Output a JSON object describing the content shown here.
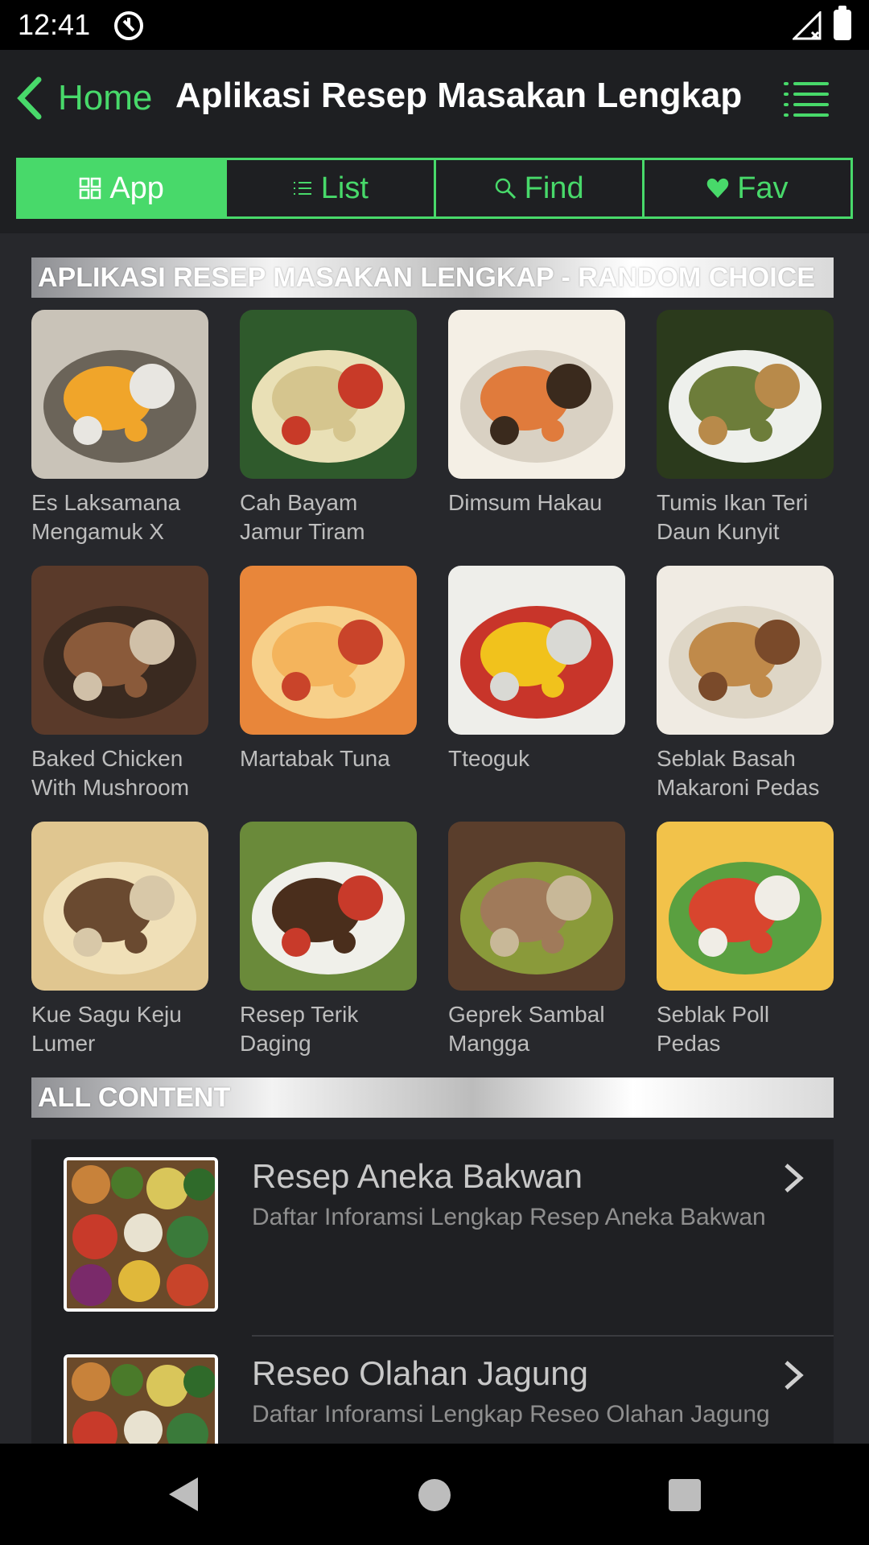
{
  "status_bar": {
    "time": "12:41"
  },
  "header": {
    "back_label": "Home",
    "title": "Aplikasi Resep Masakan Lengkap",
    "menu_icon": "list-menu-icon",
    "accent_color": "#48d96a"
  },
  "tabs": [
    {
      "label": "App",
      "icon": "grid-icon",
      "active": true
    },
    {
      "label": "List",
      "icon": "list-icon",
      "active": false
    },
    {
      "label": "Find",
      "icon": "search-icon",
      "active": false
    },
    {
      "label": "Fav",
      "icon": "heart-icon",
      "active": false
    }
  ],
  "random_section": {
    "title": "APLIKASI RESEP MASAKAN LENGKAP - RANDOM CHOICE",
    "recipes": [
      {
        "name": "Es Laksamana Mengamuk X"
      },
      {
        "name": "Cah Bayam Jamur Tiram"
      },
      {
        "name": "Dimsum Hakau"
      },
      {
        "name": "Tumis Ikan Teri Daun Kunyit"
      },
      {
        "name": "Baked Chicken With Mushroom"
      },
      {
        "name": "Martabak Tuna"
      },
      {
        "name": "Tteoguk"
      },
      {
        "name": "Seblak Basah Makaroni Pedas"
      },
      {
        "name": "Kue Sagu Keju Lumer"
      },
      {
        "name": "Resep Terik Daging"
      },
      {
        "name": "Geprek Sambal Mangga"
      },
      {
        "name": "Seblak Poll Pedas"
      }
    ]
  },
  "all_content": {
    "title": "ALL CONTENT",
    "items": [
      {
        "title": "Resep Aneka Bakwan",
        "description": "Daftar Inforamsi Lengkap Resep Aneka Bakwan"
      },
      {
        "title": "Reseo Olahan Jagung",
        "description": "Daftar Inforamsi Lengkap Reseo Olahan Jagung"
      }
    ]
  }
}
